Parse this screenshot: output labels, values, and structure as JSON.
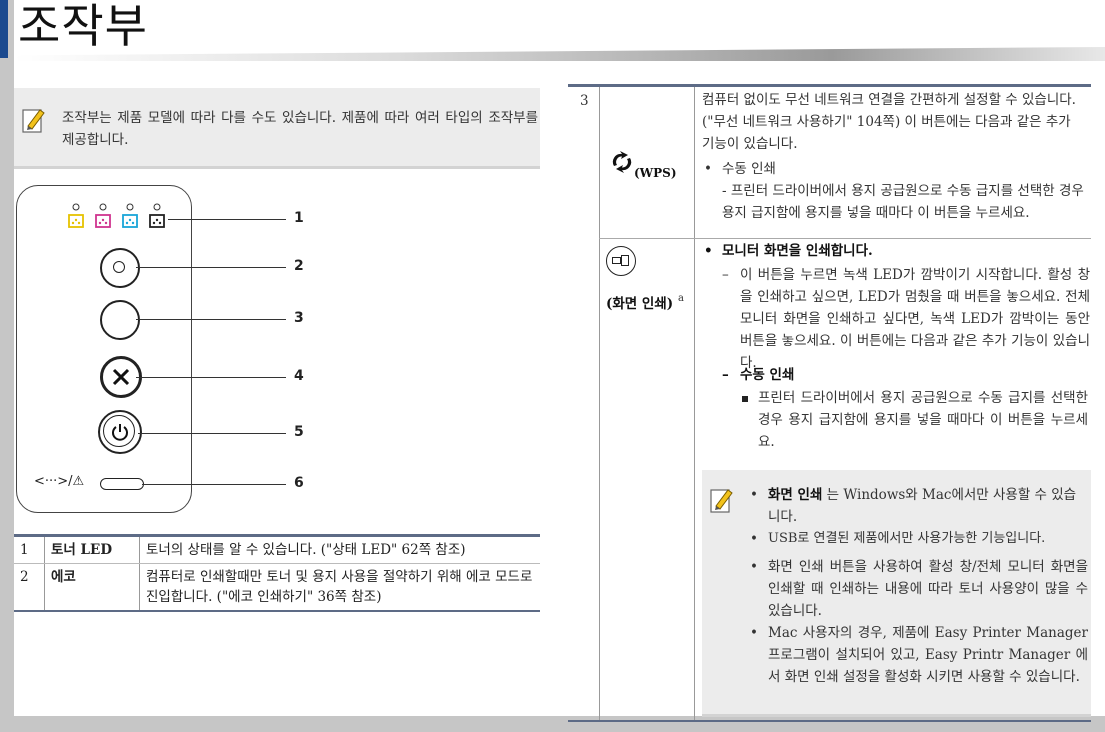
{
  "page": {
    "title": "조작부"
  },
  "top_note": {
    "text": "조작부는 제품 모델에 따라 다를 수도 있습니다. 제품에 따라 여러 타입의 조작부를 제공합니다."
  },
  "panel": {
    "bottom_label": "<···>/⚠",
    "callouts": [
      "1",
      "2",
      "3",
      "4",
      "5",
      "6"
    ]
  },
  "bottom_table": {
    "rows": [
      {
        "num": "1",
        "name": "토너 LED",
        "desc": "토너의 상태를 알 수 있습니다. (\"상태 LED\" 62쪽 참조)"
      },
      {
        "num": "2",
        "name": "에코",
        "desc": "컴퓨터로 인쇄할때만 토너 및 용지 사용을 절약하기 위해 에코 모드로 진입합니다. (\"에코 인쇄하기\" 36쪽 참조)"
      }
    ]
  },
  "right_table": {
    "row_num": "3",
    "wps": {
      "label": "(WPS)",
      "desc": "컴퓨터 없이도 무선 네트워크 연결을 간편하게 설정할 수 있습니다. (\"무선 네트워크 사용하기\" 104쪽) 이 버튼에는 다음과 같은 추가 기능이 있습니다.",
      "bullet": "수동 인쇄",
      "sub": "- 프린터 드라이버에서 용지 공급원으로 수동 급지를 선택한 경우 용지 급지함에 용지를 넣을 때마다 이 버튼을 누르세요."
    },
    "print_screen": {
      "label": "(화면 인쇄)",
      "sup": "a",
      "heading": "모니터 화면을 인쇄합니다.",
      "desc": "이 버튼을 누르면 녹색 LED가 깜박이기 시작합니다. 활성 창을 인쇄하고 싶으면, LED가 멈췄을 때 버튼을 놓으세요. 전체 모니터 화면을 인쇄하고 싶다면, 녹색 LED가 깜박이는 동안 버튼을 놓으세요. 이 버튼에는 다음과 같은 추가 기능이 있습니다.",
      "sub_heading": "수동 인쇄",
      "sub_desc": "프린터 드라이버에서 용지 공급원으로 수동 급지를 선택한 경우 용지 급지함에 용지를 넣을 때마다 이 버튼을 누르세요."
    },
    "note": {
      "item1_bold": "화면 인쇄",
      "item1_rest": " 는 Windows와 Mac에서만 사용할 수 있습니다.",
      "item2": "USB로 연결된 제품에서만 사용가능한 기능입니다.",
      "item3": "화면 인쇄 버튼을 사용하여 활성 창/전체 모니터 화면을 인쇄할 때 인쇄하는 내용에 따라 토너 사용양이 많을 수 있습니다.",
      "item4": "Mac 사용자의 경우, 제품에 Easy Printer Manager 프로그램이 설치되어 있고, Easy Printr Manager 에서 화면 인쇄 설정을 활성화 시키면 사용할 수 있습니다."
    }
  },
  "colors": {
    "accent": "#1b4a8f",
    "yellow": "#e6c200",
    "magenta": "#d0348f",
    "cyan": "#1aa6d9",
    "black": "#222222"
  }
}
